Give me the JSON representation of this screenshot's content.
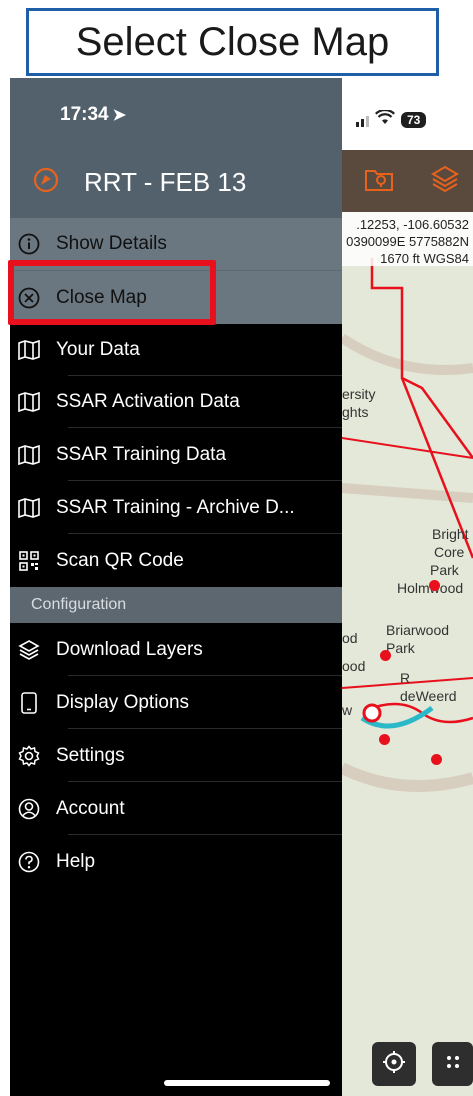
{
  "callout": {
    "text": "Select Close Map"
  },
  "status_bar": {
    "time": "17:34",
    "battery": "73"
  },
  "drawer": {
    "title": "RRT - FEB 13",
    "items": [
      {
        "label": "Show Details",
        "icon": "info-icon"
      },
      {
        "label": "Close Map",
        "icon": "close-circle-icon"
      },
      {
        "label": "Your Data",
        "icon": "map-icon"
      },
      {
        "label": "SSAR Activation Data",
        "icon": "map-icon"
      },
      {
        "label": "SSAR Training Data",
        "icon": "map-icon"
      },
      {
        "label": "SSAR Training - Archive D...",
        "icon": "map-icon"
      },
      {
        "label": "Scan QR Code",
        "icon": "qr-code-icon"
      }
    ],
    "section": "Configuration",
    "config_items": [
      {
        "label": "Download Layers",
        "icon": "layers-icon"
      },
      {
        "label": "Display Options",
        "icon": "phone-icon"
      },
      {
        "label": "Settings",
        "icon": "gear-icon"
      },
      {
        "label": "Account",
        "icon": "account-icon"
      },
      {
        "label": "Help",
        "icon": "help-icon"
      }
    ]
  },
  "map": {
    "coords_line1": ".12253, -106.60532",
    "coords_line2": "0390099E 5775882N",
    "coords_line3": "1670 ft   WGS84",
    "labels": [
      "ersity",
      "ghts",
      "Bright",
      "Core",
      "Park",
      "Holmwood",
      "Briarwood",
      "Park",
      "od",
      "ood",
      "deWeerd",
      "R",
      "w"
    ]
  },
  "colors": {
    "accent": "#e8621c",
    "highlight": "#e8101c",
    "drawer_grey": "#6a7781"
  }
}
